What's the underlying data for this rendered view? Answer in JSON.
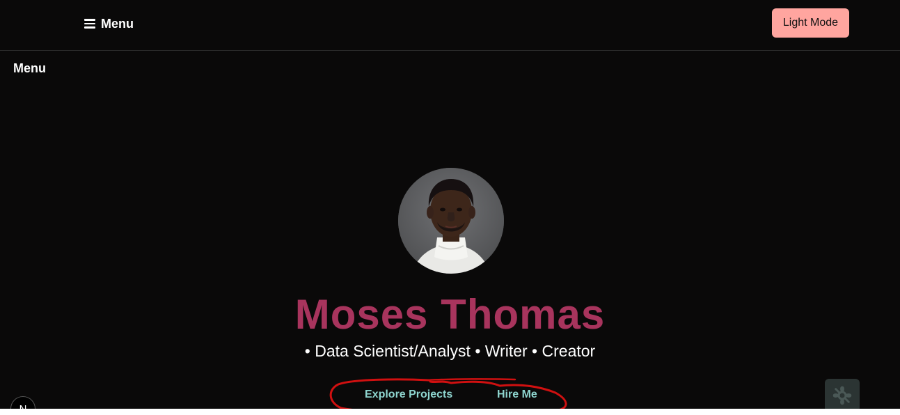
{
  "header": {
    "menu_label": "Menu",
    "theme_toggle_label": "Light Mode"
  },
  "side_menu": {
    "label": "Menu"
  },
  "hero": {
    "avatar_icon": "portrait-photo",
    "name": "Moses Thomas",
    "tagline": "• Data Scientist/Analyst • Writer • Creator",
    "cta_explore": "Explore Projects",
    "cta_hire": "Hire Me"
  },
  "footer": {
    "badge_letter": "N",
    "widget_icon": "flower-icon"
  },
  "colors": {
    "background": "#0a0909",
    "name_accent": "#a8345d",
    "theme_button": "#ffa59f",
    "cta_text": "#8fd6d0",
    "annotation_red": "#d01010"
  }
}
